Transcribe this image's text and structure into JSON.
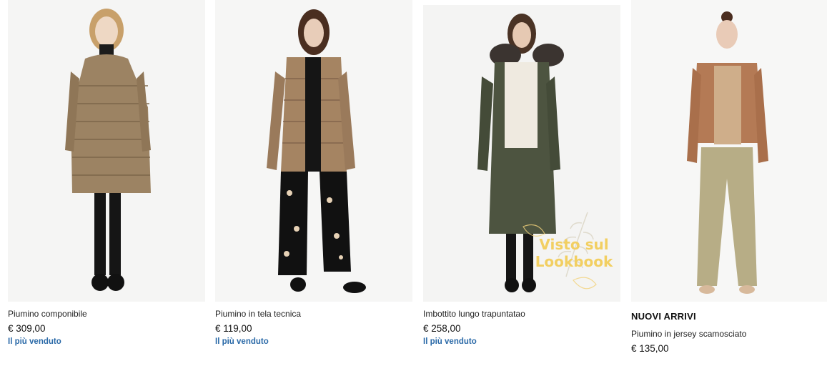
{
  "products": [
    {
      "title": "Piumino componibile",
      "price": "€ 309,00",
      "badge": "Il più venduto",
      "swatches": [
        "#2f3140",
        "#b08e6c"
      ]
    },
    {
      "title": "Piumino in tela tecnica",
      "price": "€ 119,00",
      "badge": "Il più venduto",
      "swatches": [
        "#4a4d3a",
        "#2b2b2e"
      ]
    },
    {
      "title": "Imbottito lungo trapuntatao",
      "price": "€ 258,00",
      "badge": "Il più venduto",
      "swatches": [
        "#f3ebe0",
        "#d7a07a"
      ],
      "overlay": {
        "line1": "Visto sul",
        "line2": "Lookbook"
      }
    },
    {
      "new_label": "NUOVI ARRIVI",
      "title": "Piumino in jersey scamosciato",
      "price": "€ 135,00"
    }
  ],
  "colors": {
    "badge": "#2b6aa8",
    "overlay_text": "#f2cf62",
    "photo_bg": "#f4f4f4"
  }
}
